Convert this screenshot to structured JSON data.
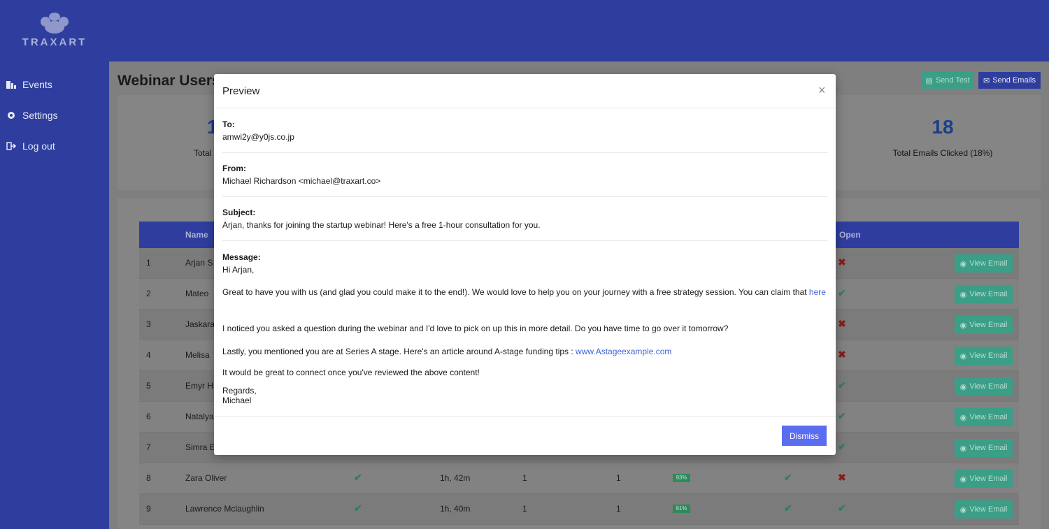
{
  "brand": {
    "logo_text": "TRAXART"
  },
  "sidebar": {
    "items": [
      {
        "label": "Events",
        "icon": "events-icon"
      },
      {
        "label": "Settings",
        "icon": "gear-icon"
      },
      {
        "label": "Log out",
        "icon": "logout-icon"
      }
    ]
  },
  "page": {
    "title": "Webinar Users",
    "send_test_label": "Send Test",
    "send_emails_label": "Send Emails"
  },
  "stats": {
    "left_number": "1",
    "left_label": "Total",
    "clicked_number": "18",
    "clicked_label": "Total Emails Clicked (18%)"
  },
  "table": {
    "headers": {
      "name": "Name",
      "open": "Open"
    },
    "view_label": "View Email",
    "rows": [
      {
        "id": "1",
        "name": "Arjan S",
        "open": false
      },
      {
        "id": "2",
        "name": "Mateo",
        "open": true
      },
      {
        "id": "3",
        "name": "Jaskara",
        "open": false
      },
      {
        "id": "4",
        "name": "Melisa",
        "open": false
      },
      {
        "id": "5",
        "name": "Emyr H",
        "open": true
      },
      {
        "id": "6",
        "name": "Natalya",
        "open": true
      },
      {
        "id": "7",
        "name": "Simra E",
        "open": true
      },
      {
        "id": "8",
        "name": "Zara Oliver",
        "attended": true,
        "duration": "1h, 42m",
        "col_a": "1",
        "col_b": "1",
        "pct": "93%",
        "clicked": true,
        "open": false
      },
      {
        "id": "9",
        "name": "Lawrence Mclaughlin",
        "attended": true,
        "duration": "1h, 40m",
        "col_a": "1",
        "col_b": "1",
        "pct": "91%",
        "clicked": true,
        "open": true
      }
    ]
  },
  "modal": {
    "title": "Preview",
    "close_glyph": "×",
    "to_label": "To:",
    "to_value": "amwi2y@y0js.co.jp",
    "from_label": "From:",
    "from_value": "Michael Richardson <michael@traxart.co>",
    "subject_label": "Subject:",
    "subject_value": "Arjan, thanks for joining the startup webinar! Here's a free 1-hour consultation for you.",
    "message_label": "Message:",
    "greeting": "Hi Arjan,",
    "para1": "Great to have you with us (and glad you could make it to the end!). We would love to help you on your journey with a free strategy session. You can claim that ",
    "para1_link": "here",
    "para2": "I noticed you asked a question during the webinar and I'd love to pick on up this in more detail. Do you have time to go over it tomorrow?",
    "para3": "Lastly, you mentioned you are at Series A stage. Here's an article around A-stage funding tips : ",
    "para3_link": "www.Astageexample.com",
    "para4": "It would be great to connect once you've reviewed the above content!",
    "signoff": "Regards,",
    "signature": "Michael",
    "dismiss_label": "Dismiss"
  },
  "colors": {
    "brand": "#2f3e9e",
    "accent_green": "#3b9e86",
    "primary_button": "#5a6cf0",
    "link": "#3f62d8"
  }
}
